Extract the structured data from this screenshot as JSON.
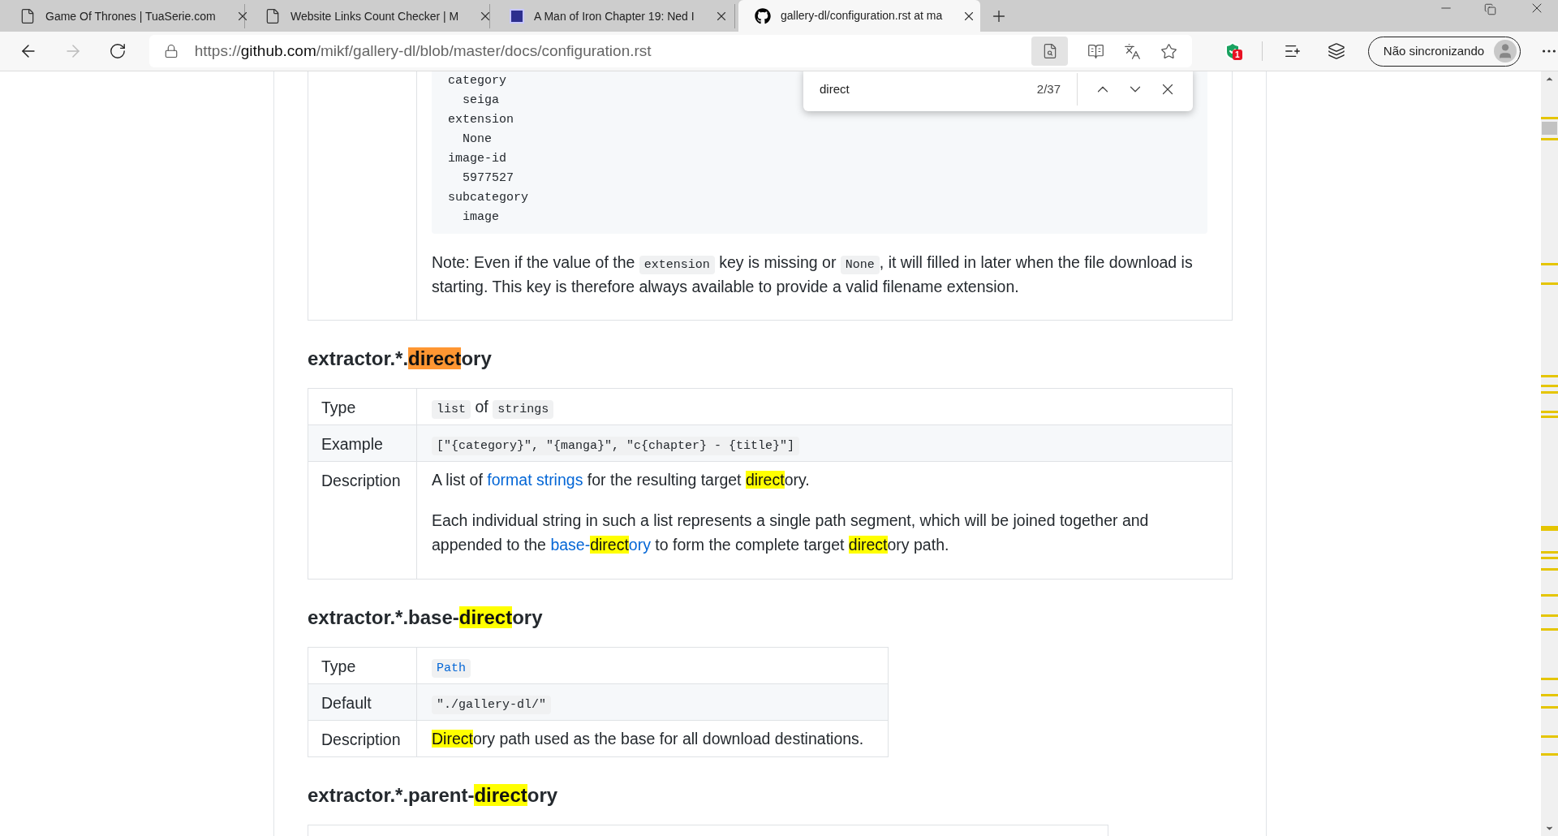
{
  "browser": {
    "tabs": [
      {
        "title": "Game Of Thrones | TuaSerie.com",
        "kind": "page",
        "selected": false
      },
      {
        "title": "Website Links Count Checker | M",
        "kind": "page",
        "selected": false
      },
      {
        "title": "A Man of Iron Chapter 19: Ned I",
        "kind": "book",
        "selected": false
      },
      {
        "title": "gallery-dl/configuration.rst at ma",
        "kind": "github",
        "selected": true
      }
    ],
    "address": {
      "scheme": "https://",
      "host": "github.com",
      "path": "/mikf/gallery-dl/blob/master/docs/configuration.rst"
    },
    "extension_badge": "1",
    "profile": "Não sincronizando"
  },
  "find_bar": {
    "query": "direct",
    "count": "2/37"
  },
  "sections": [
    {
      "kind": "table",
      "rows": [
        {
          "label": "",
          "blocks": [
            {
              "kind": "code_block",
              "lines": [
                "category",
                "  seiga",
                "extension",
                "  None",
                "image-id",
                "  5977527",
                "subcategory",
                "  image"
              ]
            },
            {
              "kind": "paragraph",
              "segments": [
                {
                  "kind": "text",
                  "text": "Note: Even if the value of the "
                },
                {
                  "kind": "code",
                  "text": "extension"
                },
                {
                  "kind": "text",
                  "text": " key is missing or "
                },
                {
                  "kind": "code",
                  "text": "None"
                },
                {
                  "kind": "text",
                  "text": ", it will filled in later when the file download is starting. This key is therefore always available to provide a valid filename extension."
                }
              ]
            }
          ]
        }
      ]
    },
    {
      "kind": "table",
      "heading": [
        {
          "text": "extractor.*.",
          "kind": "plain"
        },
        {
          "text": "direct",
          "kind": "current_match"
        },
        {
          "text": "ory",
          "kind": "plain"
        }
      ],
      "rows": [
        {
          "label": "Type",
          "blocks": [
            {
              "kind": "paragraph",
              "segments": [
                {
                  "kind": "code",
                  "text": "list"
                },
                {
                  "kind": "text",
                  "text": " of "
                },
                {
                  "kind": "code",
                  "text": "strings"
                }
              ]
            }
          ]
        },
        {
          "label": "Example",
          "blocks": [
            {
              "kind": "paragraph",
              "segments": [
                {
                  "kind": "code",
                  "text": "[\"{category}\", \"{manga}\", \"c{chapter} - {title}\"]"
                }
              ]
            }
          ]
        },
        {
          "label": "Description",
          "blocks": [
            {
              "kind": "paragraph",
              "segments": [
                {
                  "kind": "text",
                  "text": "A list of "
                },
                {
                  "kind": "link",
                  "text": "format strings"
                },
                {
                  "kind": "text",
                  "parts": [
                    {
                      "text": " for the resulting target ",
                      "kind": "plain"
                    },
                    {
                      "text": "direct",
                      "kind": "match"
                    },
                    {
                      "text": "ory.",
                      "kind": "plain"
                    }
                  ]
                }
              ]
            },
            {
              "kind": "paragraph",
              "segments": [
                {
                  "kind": "text",
                  "text": "Each individual string in such a list represents a single path segment, which will be joined together and appended to the "
                },
                {
                  "kind": "link",
                  "parts": [
                    {
                      "text": "base-",
                      "kind": "plain"
                    },
                    {
                      "text": "direct",
                      "kind": "match"
                    },
                    {
                      "text": "ory",
                      "kind": "plain"
                    }
                  ]
                },
                {
                  "kind": "text",
                  "parts": [
                    {
                      "text": " to form the complete target ",
                      "kind": "plain"
                    },
                    {
                      "text": "direct",
                      "kind": "match"
                    },
                    {
                      "text": "ory path.",
                      "kind": "plain"
                    }
                  ]
                }
              ]
            }
          ]
        }
      ]
    },
    {
      "kind": "table",
      "heading": [
        {
          "text": "extractor.*.base-",
          "kind": "plain"
        },
        {
          "text": "direct",
          "kind": "match"
        },
        {
          "text": "ory",
          "kind": "plain"
        }
      ],
      "rows": [
        {
          "label": "Type",
          "blocks": [
            {
              "kind": "paragraph",
              "segments": [
                {
                  "kind": "code_link",
                  "text": "Path"
                }
              ]
            }
          ]
        },
        {
          "label": "Default",
          "blocks": [
            {
              "kind": "paragraph",
              "segments": [
                {
                  "kind": "code",
                  "text": "\"./gallery-dl/\""
                }
              ]
            }
          ]
        },
        {
          "label": "Description",
          "blocks": [
            {
              "kind": "paragraph",
              "segments": [
                {
                  "kind": "text",
                  "parts": [
                    {
                      "text": "Direct",
                      "kind": "match"
                    },
                    {
                      "text": "ory path used as the base for all download destinations.",
                      "kind": "plain"
                    }
                  ]
                }
              ]
            }
          ]
        }
      ]
    },
    {
      "kind": "stub",
      "heading": [
        {
          "text": "extractor.*.parent-",
          "kind": "plain"
        },
        {
          "text": "direct",
          "kind": "match"
        },
        {
          "text": "ory",
          "kind": "plain"
        }
      ]
    }
  ]
}
